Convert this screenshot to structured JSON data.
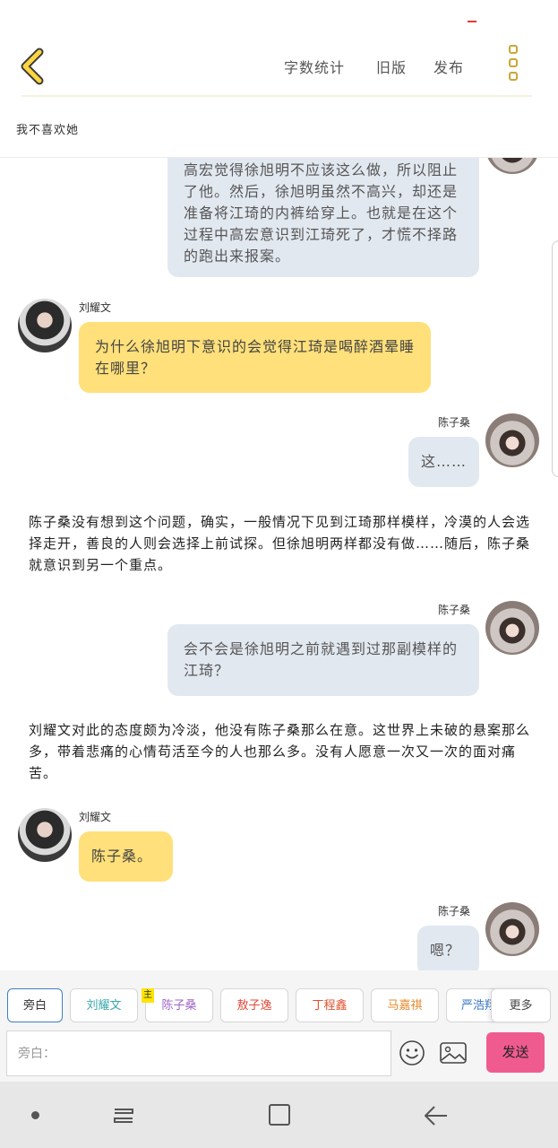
{
  "header": {
    "links": [
      "字数统计",
      "旧版",
      "发布"
    ],
    "story_title": "我不喜欢她"
  },
  "messages": [
    {
      "type": "bubble",
      "side": "right",
      "speaker": "陈子桑",
      "style": "gray",
      "text": "高宏觉得徐旭明不应该这么做，所以阻止了他。然后，徐旭明虽然不高兴，却还是准备将江琦的内裤给穿上。也就是在这个过程中高宏意识到江琦死了，才慌不择路的跑出来报案。"
    },
    {
      "type": "bubble",
      "side": "left",
      "speaker": "刘耀文",
      "style": "yellow",
      "text": "为什么徐旭明下意识的会觉得江琦是喝醉酒晕睡在哪里？"
    },
    {
      "type": "bubble",
      "side": "right",
      "speaker": "陈子桑",
      "style": "gray",
      "text": "这……"
    },
    {
      "type": "narration",
      "text": "陈子桑没有想到这个问题，确实，一般情况下见到江琦那样模样，冷漠的人会选择走开，善良的人则会选择上前试探。但徐旭明两样都没有做……随后，陈子桑就意识到另一个重点。"
    },
    {
      "type": "bubble",
      "side": "right",
      "speaker": "陈子桑",
      "style": "gray",
      "text": "会不会是徐旭明之前就遇到过那副模样的江琦？"
    },
    {
      "type": "narration",
      "text": "刘耀文对此的态度颇为冷淡，他没有陈子桑那么在意。这世界上未破的悬案那么多，带着悲痛的心情苟活至今的人也那么多。没有人愿意一次又一次的面对痛苦。"
    },
    {
      "type": "bubble",
      "side": "left",
      "speaker": "刘耀文",
      "style": "yellow",
      "text": "陈子桑。"
    },
    {
      "type": "bubble",
      "side": "right",
      "speaker": "陈子桑",
      "style": "gray",
      "text": "嗯？"
    }
  ],
  "roles": {
    "chips": [
      {
        "label": "旁白",
        "color": "#555555",
        "active": true
      },
      {
        "label": "刘耀文",
        "color": "#3aa7a7"
      },
      {
        "label": "陈子桑",
        "color": "#a065c7"
      },
      {
        "label": "敖子逸",
        "color": "#e04a3a"
      },
      {
        "label": "丁程鑫",
        "color": "#e0502e"
      },
      {
        "label": "马嘉祺",
        "color": "#e58a2c"
      },
      {
        "label": "严浩翔",
        "color": "#3b78c4"
      }
    ],
    "main_badge": "主",
    "more_label": "更多"
  },
  "input": {
    "placeholder": "旁白：",
    "send_label": "发送"
  },
  "icons": {
    "back": "chevron-left-icon",
    "more": "vertical-dots-icon",
    "emoji": "smiley-icon",
    "image": "image-icon"
  },
  "colors": {
    "accent_yellow": "#ffe07a",
    "bubble_gray": "#e2e8f0",
    "send_pink": "#f05b8f",
    "active_border": "#3f7fc7"
  }
}
